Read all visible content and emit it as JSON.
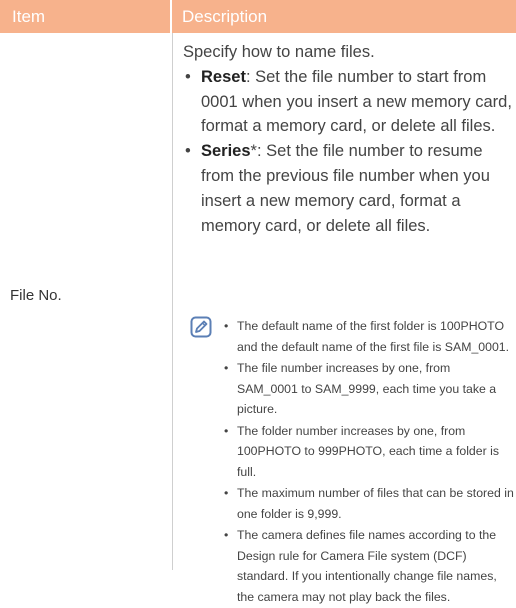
{
  "header": {
    "col_item": "Item",
    "col_description": "Description"
  },
  "row": {
    "item": "File No.",
    "intro": "Specify how to name files.",
    "options": [
      {
        "term": "Reset",
        "text": ": Set the file number to start from 0001 when you insert a new memory card, format a memory card, or delete all files."
      },
      {
        "term": "Series",
        "text": "*: Set the file number to resume from the previous file number when you insert a new memory card, format a memory card, or delete all files."
      }
    ],
    "notes": [
      "The default name of the first folder is 100PHOTO and the default name of the first file is SAM_0001.",
      "The file number increases by one, from SAM_0001 to SAM_9999, each time you take a picture.",
      "The folder number increases by one, from 100PHOTO to 999PHOTO, each time a folder is full.",
      "The maximum number of files that can be stored in one folder is 9,999.",
      "The camera defines file names according to the Design rule for Camera File system (DCF) standard. If you intentionally change file names, the camera may not play back the files."
    ]
  },
  "colors": {
    "header_bg": "#f7b28c",
    "icon": "#5b7fb5"
  },
  "icons": {
    "note": "note-pencil-icon"
  }
}
